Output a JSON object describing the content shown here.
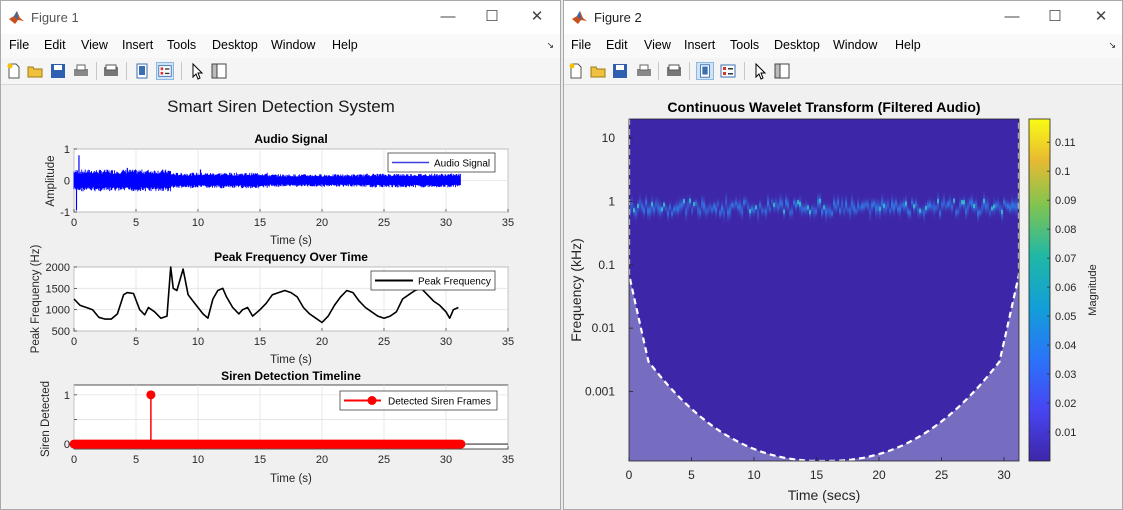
{
  "figure1": {
    "window_title": "Figure 1",
    "menu": [
      "File",
      "Edit",
      "View",
      "Insert",
      "Tools",
      "Desktop",
      "Window",
      "Help"
    ],
    "suptitle": "Smart Siren Detection System"
  },
  "figure2": {
    "window_title": "Figure 2",
    "menu": [
      "File",
      "Edit",
      "View",
      "Insert",
      "Tools",
      "Desktop",
      "Window",
      "Help"
    ]
  },
  "toolbar_icons": [
    "new-figure-icon",
    "open-file-icon",
    "save-icon",
    "print-icon",
    "print-preview-icon",
    "dock-figure-icon",
    "property-editor-icon",
    "select-pointer-icon",
    "show-plot-tools-icon"
  ],
  "colors": {
    "audio": "#0000ff",
    "peak": "#000000",
    "siren": "#ff0000",
    "cwt_background": "#3e26a8",
    "cwt_band": "#3a8fe0",
    "cone": "#ffffff"
  },
  "chart_data": [
    {
      "type": "line",
      "title": "Audio Signal",
      "xlabel": "Time (s)",
      "ylabel": "Amplitude",
      "xlim": [
        0,
        35
      ],
      "ylim": [
        -1,
        1
      ],
      "xticks": [
        "0",
        "5",
        "10",
        "15",
        "20",
        "25",
        "30",
        "35"
      ],
      "yticks": [
        "-1",
        "0",
        "1"
      ],
      "grid": true,
      "legend": "top-right",
      "series": [
        {
          "name": "Audio Signal",
          "x_range": [
            0,
            31.2
          ],
          "envelope_min": [
            -0.35,
            -0.25,
            -0.2,
            -0.22
          ],
          "envelope_max": [
            0.35,
            0.25,
            0.2,
            0.22
          ],
          "spikes": [
            [
              0.2,
              -0.95
            ],
            [
              0.4,
              0.8
            ],
            [
              4.3,
              0.4
            ],
            [
              10.2,
              0.35
            ]
          ]
        }
      ]
    },
    {
      "type": "line",
      "title": "Peak Frequency Over Time",
      "xlabel": "Time (s)",
      "ylabel": "Peak Frequency (Hz)",
      "xlim": [
        0,
        35
      ],
      "ylim": [
        500,
        2000
      ],
      "xticks": [
        "0",
        "5",
        "10",
        "15",
        "20",
        "25",
        "30",
        "35"
      ],
      "yticks": [
        "500",
        "1000",
        "1500",
        "2000"
      ],
      "grid": true,
      "legend": "top-right",
      "series": [
        {
          "name": "Peak Frequency",
          "x": [
            0,
            0.5,
            1,
            1.5,
            2,
            2.5,
            3,
            3.5,
            4,
            4.3,
            4.8,
            5.3,
            5.7,
            6,
            6.5,
            7,
            7.5,
            7.8,
            8,
            8.3,
            8.8,
            9.2,
            9.6,
            10,
            10.4,
            10.8,
            11.2,
            11.6,
            12,
            12.3,
            12.8,
            13.3,
            13.6,
            14,
            14.4,
            15,
            15.5,
            16,
            16.5,
            17,
            17.5,
            18,
            18.5,
            19,
            19.5,
            20,
            20.5,
            21,
            21.5,
            22,
            22.5,
            23,
            23.5,
            24,
            24.5,
            25,
            25.5,
            26,
            26.5,
            27,
            27.5,
            28,
            28.5,
            29,
            29.5,
            30,
            30.3,
            30.6,
            31
          ],
          "values": [
            1250,
            1100,
            1050,
            1000,
            820,
            780,
            780,
            900,
            1350,
            1400,
            1380,
            1000,
            880,
            1050,
            950,
            800,
            850,
            2000,
            1500,
            1450,
            1950,
            1350,
            1200,
            1050,
            900,
            800,
            1250,
            1450,
            1500,
            1300,
            1050,
            900,
            1000,
            1050,
            850,
            1000,
            1150,
            1350,
            1400,
            1450,
            1400,
            1300,
            1050,
            900,
            800,
            700,
            850,
            1100,
            1300,
            1450,
            1400,
            1200,
            1050,
            950,
            850,
            800,
            850,
            950,
            1250,
            1350,
            1450,
            1500,
            1350,
            1200,
            1100,
            950,
            800,
            1000,
            1050
          ]
        }
      ]
    },
    {
      "type": "stem",
      "title": "Siren Detection Timeline",
      "xlabel": "Time (s)",
      "ylabel": "Siren Detected",
      "xlim": [
        0,
        35
      ],
      "ylim": [
        -0.1,
        1.2
      ],
      "xticks": [
        "0",
        "5",
        "10",
        "15",
        "20",
        "25",
        "30",
        "35"
      ],
      "yticks": [
        "0",
        "0.5",
        "1"
      ],
      "grid": true,
      "legend": "top-right",
      "series": [
        {
          "name": "Detected Siren Frames",
          "x_range": [
            0,
            31.2
          ],
          "baseline": 0,
          "detections": [
            [
              6.2,
              1
            ]
          ]
        }
      ]
    },
    {
      "type": "heatmap",
      "title": "Continuous Wavelet Transform (Filtered Audio)",
      "xlabel": "Time (secs)",
      "ylabel": "Frequency (kHz)",
      "xlim": [
        0,
        31.2
      ],
      "ylog": true,
      "ylim": [
        8e-05,
        20
      ],
      "xticks": [
        "0",
        "5",
        "10",
        "15",
        "20",
        "25",
        "30"
      ],
      "yticks": [
        "10",
        "1",
        "0.1",
        "0.01",
        "0.001"
      ],
      "colorbar": {
        "label": "Magnitude",
        "ticks": [
          "0.01",
          "0.02",
          "0.03",
          "0.04",
          "0.05",
          "0.06",
          "0.07",
          "0.08",
          "0.09",
          "0.1",
          "0.11"
        ],
        "min": 0,
        "max": 0.118,
        "colormap": "parula"
      },
      "band": {
        "center_khz": 0.8,
        "peak_magnitude": 0.11
      },
      "cone_of_influence": {
        "min_khz": 8e-05,
        "center_time": 15.6,
        "edge_time": [
          0,
          31.2
        ]
      }
    }
  ]
}
